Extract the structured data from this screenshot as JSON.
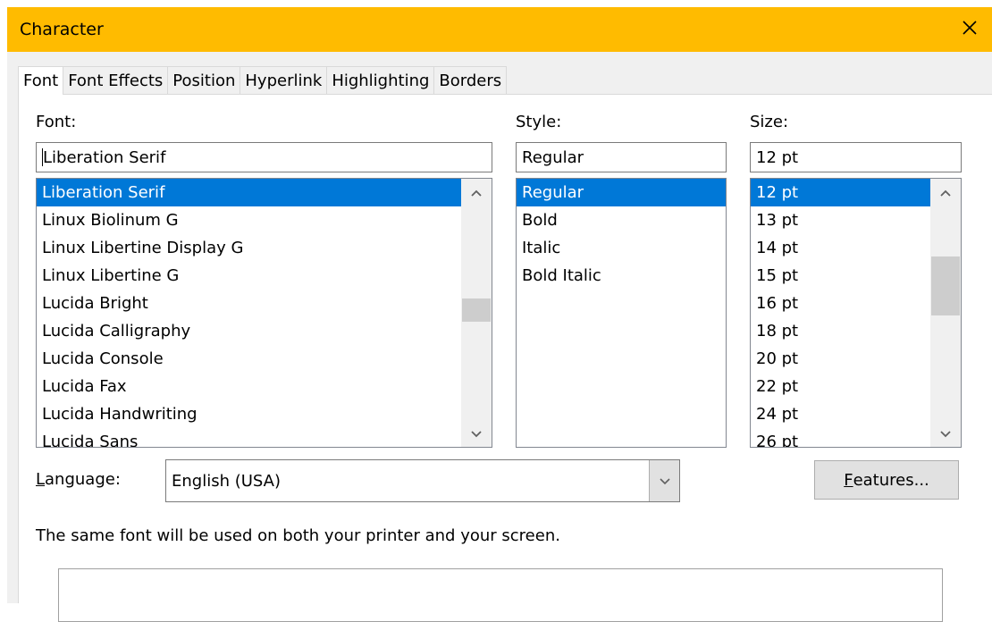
{
  "window": {
    "title": "Character",
    "close_glyph": "✕"
  },
  "tabs": [
    {
      "label": "Font",
      "active": true
    },
    {
      "label": "Font Effects"
    },
    {
      "label": "Position"
    },
    {
      "label": "Hyperlink"
    },
    {
      "label": "Highlighting"
    },
    {
      "label": "Borders"
    }
  ],
  "font": {
    "label": "Font:",
    "value": "Liberation Serif",
    "items": [
      "Liberation Serif",
      "Linux Biolinum G",
      "Linux Libertine Display G",
      "Linux Libertine G",
      "Lucida Bright",
      "Lucida Calligraphy",
      "Lucida Console",
      "Lucida Fax",
      "Lucida Handwriting",
      "Lucida Sans"
    ],
    "selected_index": 0
  },
  "style": {
    "label": "Style:",
    "value": "Regular",
    "items": [
      "Regular",
      "Bold",
      "Italic",
      "Bold Italic"
    ],
    "selected_index": 0
  },
  "size": {
    "label": "Size:",
    "value": "12 pt",
    "items": [
      "12 pt",
      "13 pt",
      "14 pt",
      "15 pt",
      "16 pt",
      "18 pt",
      "20 pt",
      "22 pt",
      "24 pt",
      "26 pt"
    ],
    "selected_index": 0
  },
  "language": {
    "label_mnemonic": "L",
    "label_rest": "anguage:",
    "value": "English (USA)"
  },
  "features_button": {
    "mnemonic": "F",
    "rest": "eatures..."
  },
  "info_text": "The same font will be used on both your printer and your screen.",
  "icons": {
    "close": "close-icon",
    "scroll_up": "chevron-up-icon",
    "scroll_down": "chevron-down-icon",
    "dropdown": "chevron-down-icon"
  },
  "colors": {
    "titlebar": "#ffbb00",
    "selection": "#0078d7"
  }
}
